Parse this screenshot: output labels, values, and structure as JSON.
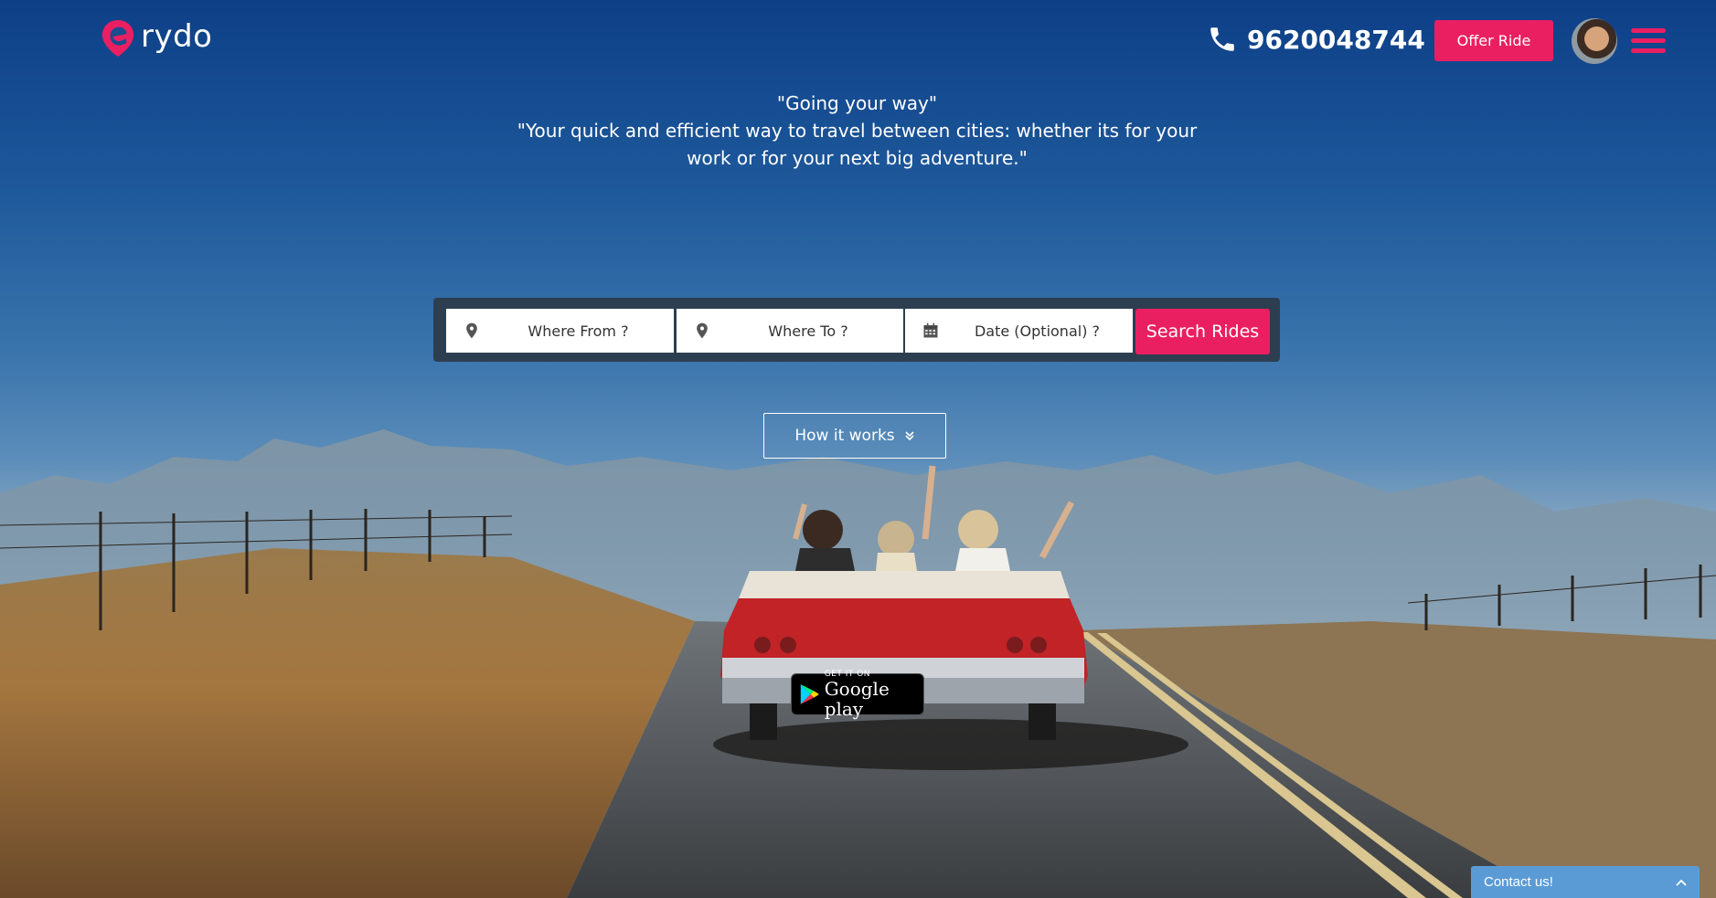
{
  "brand": {
    "name": "rydo",
    "accent": "#ea1f62"
  },
  "header": {
    "phone": "9620048744",
    "offer_ride_label": "Offer Ride"
  },
  "tagline": {
    "line1": "\"Going your way\"",
    "line2": "\"Your quick and efficient way to travel between cities: whether its for your work or for your next big adventure.\""
  },
  "search": {
    "from_placeholder": "Where From ?",
    "to_placeholder": "Where To ?",
    "date_placeholder": "Date (Optional) ?",
    "button_label": "Search Rides"
  },
  "how_it_works_label": "How it works",
  "google_play": {
    "small": "GET IT ON",
    "big": "Google play"
  },
  "contact": {
    "label": "Contact us!"
  },
  "icons": [
    "logo-icon",
    "phone-icon",
    "avatar",
    "hamburger-menu-icon",
    "location-pin-icon",
    "calendar-icon",
    "chevron-double-down-icon",
    "google-play-icon",
    "chevron-up-icon"
  ]
}
